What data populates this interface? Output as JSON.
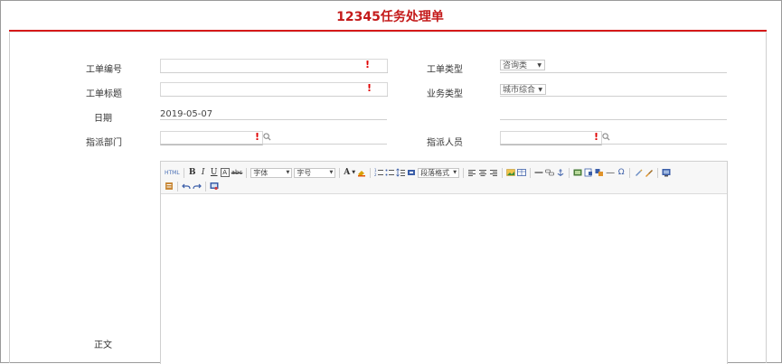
{
  "header": {
    "title": "12345任务处理单"
  },
  "form": {
    "order_no_label": "工单编号",
    "order_type_label": "工单类型",
    "order_type_value": "咨询类",
    "title_label": "工单标题",
    "biz_type_label": "业务类型",
    "biz_type_value": "城市综合",
    "date_label": "日期",
    "date_value": "2019-05-07",
    "dept_label": "指派部门",
    "person_label": "指派人员",
    "body_label": "正文",
    "required_mark": "!"
  },
  "editor": {
    "font_family_placeholder": "字体",
    "font_size_placeholder": "字号",
    "paragraph_format_placeholder": "段落格式",
    "bold": "B",
    "italic": "I",
    "underline": "U",
    "font_color_glyph": "A",
    "source_label": "HTML",
    "omega": "Ω"
  },
  "colors": {
    "brand_red": "#c41a1a",
    "required_red": "#e00000"
  }
}
